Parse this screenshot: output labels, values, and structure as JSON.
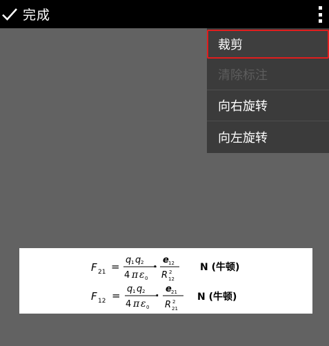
{
  "toolbar": {
    "done_label": "完成",
    "done_icon": "check-icon",
    "more_icon": "overflow-menu-icon"
  },
  "menu": {
    "items": [
      {
        "label": "裁剪",
        "state": "highlighted"
      },
      {
        "label": "清除标注",
        "state": "disabled"
      },
      {
        "label": "向右旋转",
        "state": "enabled"
      },
      {
        "label": "向左旋转",
        "state": "enabled"
      }
    ]
  },
  "formula": {
    "f21": {
      "var": "F",
      "sub": "21",
      "num_a": "q",
      "num_a_sub": "1",
      "num_b": "q",
      "num_b_sub": "2",
      "den_coef": "4",
      "den_pi": "π",
      "den_eps": "ε",
      "den_eps_sub": "0",
      "dot": "·",
      "e_var": "e",
      "e_sub": "12",
      "r_var": "R",
      "r_sub": "12",
      "r_sup": "2",
      "unit": "N (牛顿)"
    },
    "f12": {
      "var": "F",
      "sub": "12",
      "num_a": "q",
      "num_a_sub": "1",
      "num_b": "q",
      "num_b_sub": "2",
      "den_coef": "4",
      "den_pi": "π",
      "den_eps": "ε",
      "den_eps_sub": "0",
      "dot": "·",
      "e_var": "e",
      "e_sub": "21",
      "r_var": "R",
      "r_sub": "21",
      "r_sup": "2",
      "unit": "N (牛顿)"
    },
    "equals": "="
  }
}
